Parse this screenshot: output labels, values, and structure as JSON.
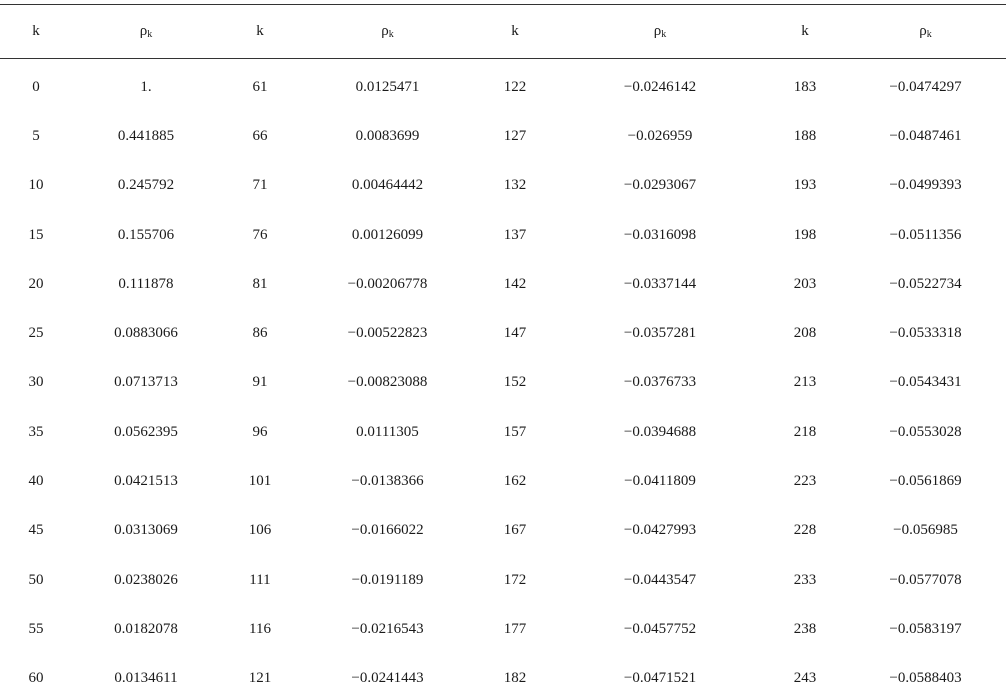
{
  "header": {
    "k_label": "k",
    "rho_symbol": "ρ",
    "rho_subscript": "k"
  },
  "rows": [
    {
      "k1": "0",
      "r1": "1.",
      "k2": "61",
      "r2": "0.0125471",
      "k3": "122",
      "r3": "−0.0246142",
      "k4": "183",
      "r4": "−0.0474297"
    },
    {
      "k1": "5",
      "r1": "0.441885",
      "k2": "66",
      "r2": "0.0083699",
      "k3": "127",
      "r3": "−0.026959",
      "k4": "188",
      "r4": "−0.0487461"
    },
    {
      "k1": "10",
      "r1": "0.245792",
      "k2": "71",
      "r2": "0.00464442",
      "k3": "132",
      "r3": "−0.0293067",
      "k4": "193",
      "r4": "−0.0499393"
    },
    {
      "k1": "15",
      "r1": "0.155706",
      "k2": "76",
      "r2": "0.00126099",
      "k3": "137",
      "r3": "−0.0316098",
      "k4": "198",
      "r4": "−0.0511356"
    },
    {
      "k1": "20",
      "r1": "0.111878",
      "k2": "81",
      "r2": "−0.00206778",
      "k3": "142",
      "r3": "−0.0337144",
      "k4": "203",
      "r4": "−0.0522734"
    },
    {
      "k1": "25",
      "r1": "0.0883066",
      "k2": "86",
      "r2": "−0.00522823",
      "k3": "147",
      "r3": "−0.0357281",
      "k4": "208",
      "r4": "−0.0533318"
    },
    {
      "k1": "30",
      "r1": "0.0713713",
      "k2": "91",
      "r2": "−0.00823088",
      "k3": "152",
      "r3": "−0.0376733",
      "k4": "213",
      "r4": "−0.0543431"
    },
    {
      "k1": "35",
      "r1": "0.0562395",
      "k2": "96",
      "r2": "0.0111305",
      "k3": "157",
      "r3": "−0.0394688",
      "k4": "218",
      "r4": "−0.0553028"
    },
    {
      "k1": "40",
      "r1": "0.0421513",
      "k2": "101",
      "r2": "−0.0138366",
      "k3": "162",
      "r3": "−0.0411809",
      "k4": "223",
      "r4": "−0.0561869"
    },
    {
      "k1": "45",
      "r1": "0.0313069",
      "k2": "106",
      "r2": "−0.0166022",
      "k3": "167",
      "r3": "−0.0427993",
      "k4": "228",
      "r4": "−0.056985"
    },
    {
      "k1": "50",
      "r1": "0.0238026",
      "k2": "111",
      "r2": "−0.0191189",
      "k3": "172",
      "r3": "−0.0443547",
      "k4": "233",
      "r4": "−0.0577078"
    },
    {
      "k1": "55",
      "r1": "0.0182078",
      "k2": "116",
      "r2": "−0.0216543",
      "k3": "177",
      "r3": "−0.0457752",
      "k4": "238",
      "r4": "−0.0583197"
    },
    {
      "k1": "60",
      "r1": "0.0134611",
      "k2": "121",
      "r2": "−0.0241443",
      "k3": "182",
      "r3": "−0.0471521",
      "k4": "243",
      "r4": "−0.0588403"
    }
  ]
}
